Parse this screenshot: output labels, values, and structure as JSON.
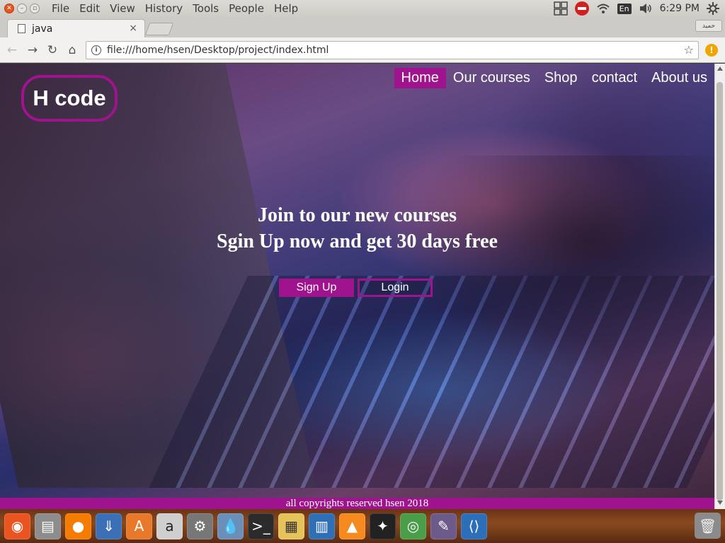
{
  "topbar": {
    "menu": [
      "File",
      "Edit",
      "View",
      "History",
      "Tools",
      "People",
      "Help"
    ],
    "keyboard_layout": "En",
    "clock": "6:29 PM"
  },
  "browser": {
    "tab_title": "java",
    "tab_close": "×",
    "profile_label": "حميد",
    "url": "file:///home/hsen/Desktop/project/index.html",
    "alert_badge": "!"
  },
  "page": {
    "brand": "H code",
    "nav": [
      "Home",
      "Our courses",
      "Shop",
      "contact",
      "About us"
    ],
    "hero_line1": "Join to our new courses",
    "hero_line2": "Sgin Up now and get 30 days free",
    "signup_label": "Sign Up",
    "login_label": "Login",
    "footer": "all copyrights reserved hsen 2018",
    "accent_color": "#a0138e"
  },
  "dock": {
    "apps": [
      "ubuntu-icon",
      "files-icon",
      "firefox-icon",
      "transmission-icon",
      "software-center-icon",
      "amazon-icon",
      "system-settings-icon",
      "drop-icon",
      "terminal-icon",
      "image-viewer-icon",
      "writer-icon",
      "vlc-icon",
      "inkscape-icon",
      "chrome-icon",
      "brush-icon",
      "vscode-icon"
    ],
    "trash": "trash-icon"
  }
}
